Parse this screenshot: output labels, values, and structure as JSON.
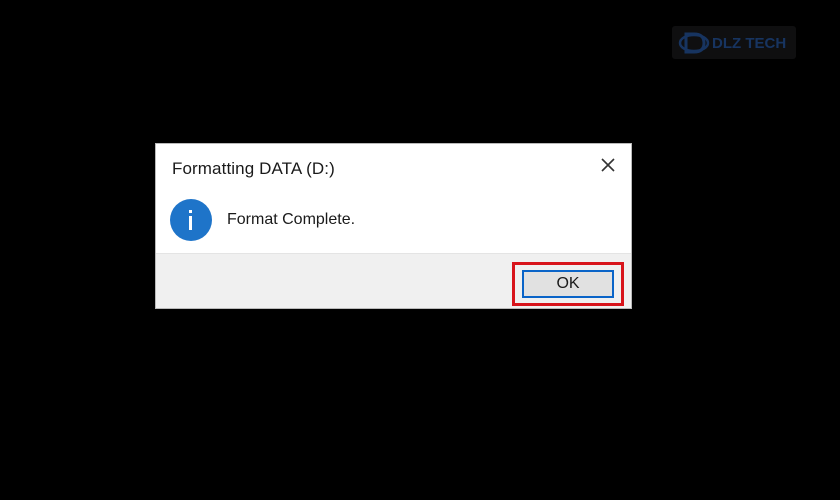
{
  "watermark": {
    "logo_text": "DLZ TECH",
    "icon": "dlz-logo-icon"
  },
  "dialog": {
    "title": "Formatting DATA (D:)",
    "message": "Format Complete.",
    "icon": "info-icon",
    "close_icon": "close-icon",
    "ok_label": "OK",
    "highlight_color": "#d8141b",
    "icon_color": "#1e74c9",
    "focus_color": "#0a64c8"
  }
}
